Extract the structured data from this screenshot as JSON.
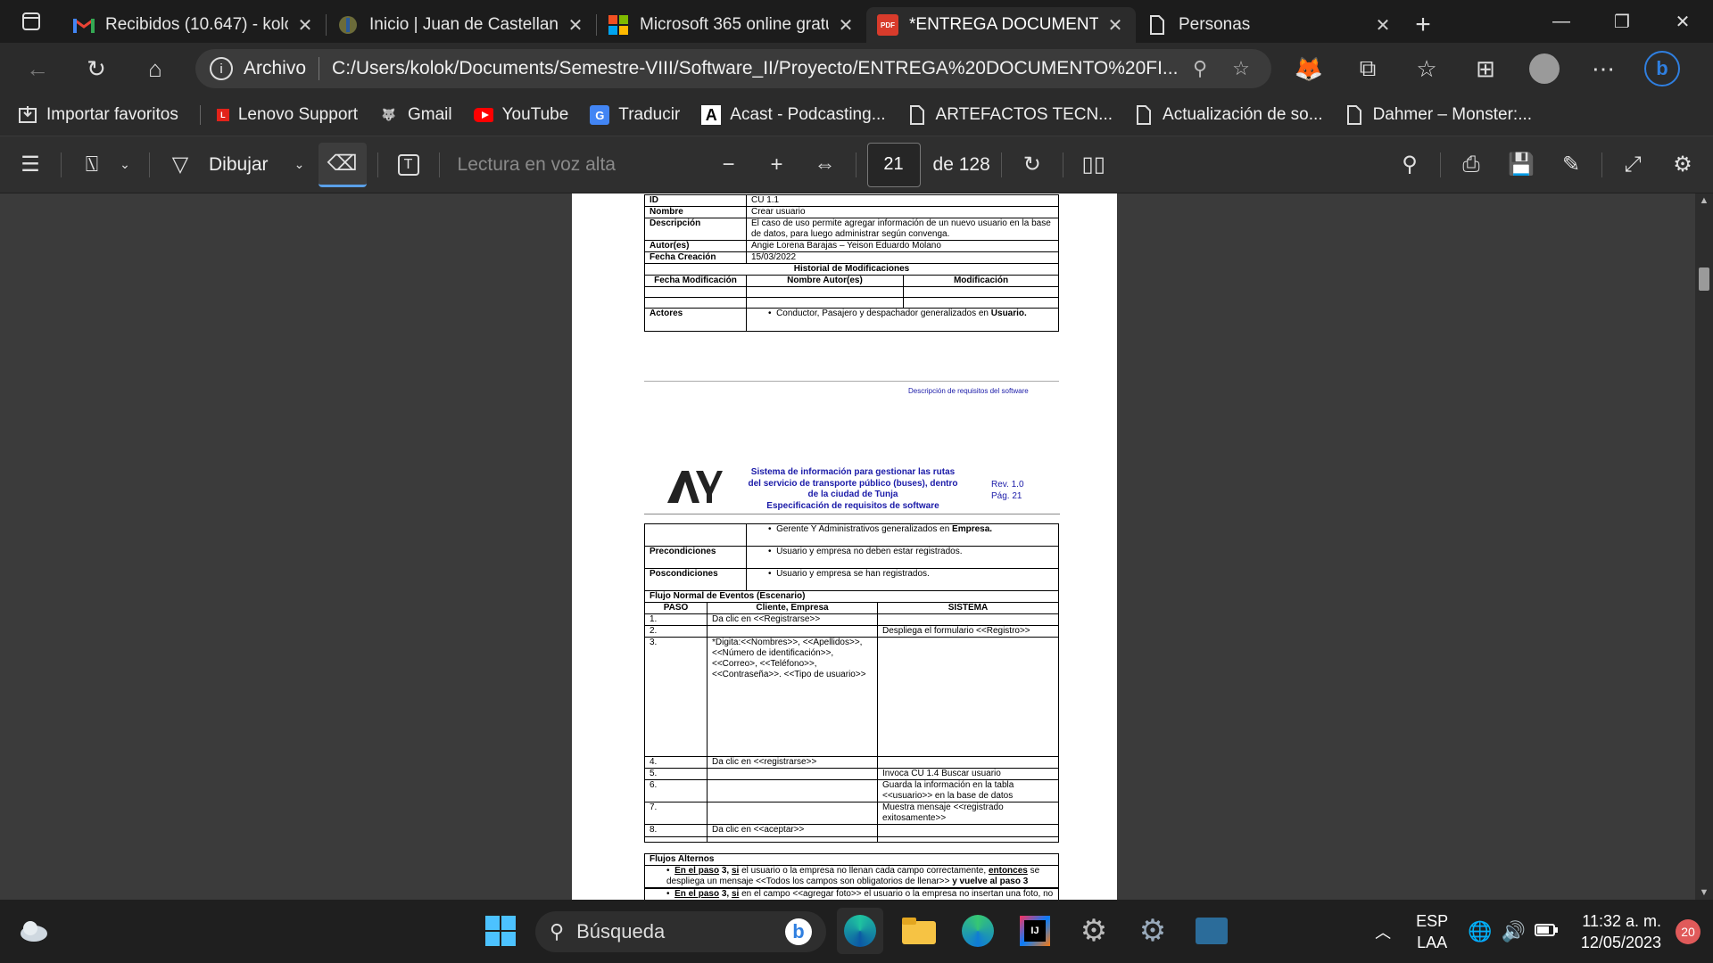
{
  "browser": {
    "tabs": [
      {
        "title": "Recibidos (10.647) - kolok",
        "icon": "gmail-icon"
      },
      {
        "title": "Inicio | Juan de Castellanos",
        "icon": "university-icon"
      },
      {
        "title": "Microsoft 365 online gratu",
        "icon": "microsoft-icon"
      },
      {
        "title": "*ENTREGA DOCUMENTO",
        "icon": "pdf-icon",
        "active": true
      },
      {
        "title": "Personas",
        "icon": "page-icon"
      }
    ],
    "address": {
      "scheme": "Archivo",
      "url": "C:/Users/kolok/Documents/Semestre-VIII/Software_II/Proyecto/ENTREGA%20DOCUMENTO%20FI..."
    },
    "favorites": [
      {
        "label": "Importar favoritos",
        "icon": "import-icon"
      },
      {
        "label": "Lenovo Support",
        "icon": "lenovo-icon"
      },
      {
        "label": "Gmail",
        "icon": "wolf-icon"
      },
      {
        "label": "YouTube",
        "icon": "youtube-icon"
      },
      {
        "label": "Traducir",
        "icon": "translate-icon"
      },
      {
        "label": "Acast - Podcasting...",
        "icon": "acast-icon"
      },
      {
        "label": "ARTEFACTOS TECN...",
        "icon": "page-icon"
      },
      {
        "label": "Actualización de so...",
        "icon": "page-icon"
      },
      {
        "label": "Dahmer – Monster:...",
        "icon": "page-icon"
      }
    ]
  },
  "pdf_toolbar": {
    "draw_label": "Dibujar",
    "read_aloud": "Lectura en voz alta",
    "page_current": "21",
    "page_total": "de 128"
  },
  "page1": {
    "rows": [
      {
        "label": "ID",
        "value": "CU 1.1"
      },
      {
        "label": "Nombre",
        "value": "Crear usuario"
      },
      {
        "label": "Descripción",
        "value": "El caso de uso permite agregar información de un nuevo usuario en la base de datos, para luego administrar según convenga."
      },
      {
        "label": "Autor(es)",
        "value": "Angie Lorena Barajas – Yeison Eduardo Molano"
      },
      {
        "label": "Fecha Creación",
        "value": "15/03/2022"
      }
    ],
    "history_title": "Historial de Modificaciones",
    "history_cols": [
      "Fecha Modificación",
      "Nombre Autor(es)",
      "Modificación"
    ],
    "actors_label": "Actores",
    "actors_value_pre": "Conductor, Pasajero y despachador generalizados en ",
    "actors_value_bold": "Usuario.",
    "footer": "Descripción de requisitos del software"
  },
  "page2": {
    "header_title": "Sistema de información para gestionar las rutas del servicio de transporte público (buses), dentro de la ciudad de Tunja Especificación de requisitos de software",
    "header_line1": "Sistema de información para gestionar las rutas",
    "header_line2": "del servicio de transporte público (buses), dentro",
    "header_line3": "de la ciudad de Tunja",
    "header_line4": "Especificación de requisitos de software",
    "rev": "Rev. 1.0",
    "pag": "Pág. 21",
    "actors_cont_pre": "Gerente Y Administrativos generalizados en ",
    "actors_cont_bold": "Empresa.",
    "pre_label": "Precondiciones",
    "pre_value": "Usuario y empresa no deben estar registrados.",
    "post_label": "Poscondiciones",
    "post_value": "Usuario y empresa se han registrados.",
    "flow_title": "Flujo Normal de Eventos (Escenario)",
    "flow_cols": [
      "PASO",
      "Cliente, Empresa",
      "SISTEMA"
    ],
    "flow": [
      {
        "step": "1.",
        "client": "Da clic en <<Registrarse>>",
        "system": ""
      },
      {
        "step": "2.",
        "client": "",
        "system": "Despliega el formulario <<Registro>>"
      },
      {
        "step": "3.",
        "client": "*Digita:<<Nombres>>, <<Apellidos>>, <<Número de identificación>>, <<Correo>, <<Teléfono>>, <<Contraseña>>. <<Tipo de usuario>>",
        "system": ""
      },
      {
        "step": "4.",
        "client": "Da clic en <<registrarse>>",
        "system": ""
      },
      {
        "step": "5.",
        "client": "",
        "system": "Invoca CU 1.4 Buscar usuario"
      },
      {
        "step": "6.",
        "client": "",
        "system": "Guarda la información en la tabla <<usuario>> en la base de datos"
      },
      {
        "step": "7.",
        "client": "",
        "system": "Muestra mensaje <<registrado exitosamente>>"
      },
      {
        "step": "8.",
        "client": "Da clic en <<aceptar>>",
        "system": ""
      }
    ],
    "alt_title": "Flujos Alternos",
    "alt1_a": "En el paso",
    "alt1_b": " 3, ",
    "alt1_c": "si",
    "alt1_d": " el usuario o la empresa no llenan cada campo correctamente, ",
    "alt1_e": "entonces",
    "alt1_f": " se despliega un mensaje <<Todos los campos son obligatorios de llenar>> ",
    "alt1_g": "y vuelve al paso 3",
    "alt2_a": "En el paso",
    "alt2_b": " 3, ",
    "alt2_c": "si",
    "alt2_d": " en el campo <<agregar foto>> el usuario o la empresa no insertan una foto, no hay problema, no es obligatorio."
  },
  "taskbar": {
    "search_placeholder": "Búsqueda",
    "lang1": "ESP",
    "lang2": "LAA",
    "time": "11:32 a. m.",
    "date": "12/05/2023",
    "notif_count": "20"
  },
  "colors": {
    "accent_blue": "#1a1aa8",
    "active_tab": "#2b2b2b",
    "youtube_red": "#ff0000"
  }
}
